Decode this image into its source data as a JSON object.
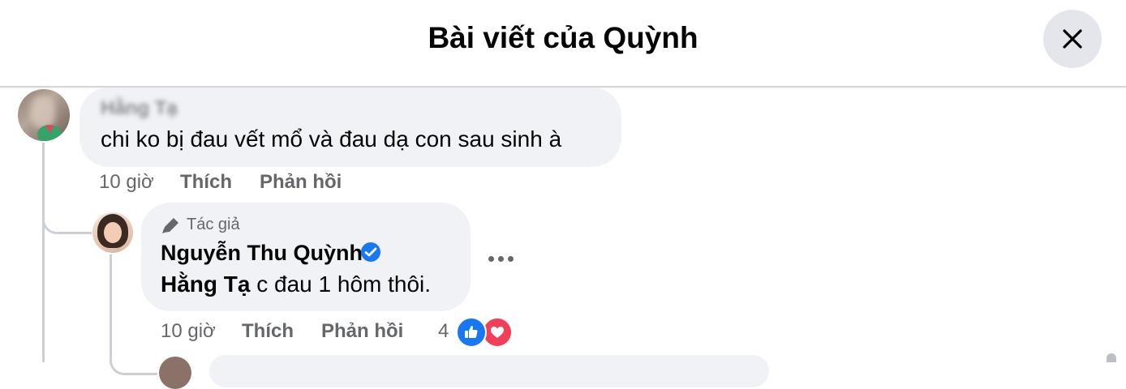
{
  "header": {
    "title": "Bài viết của Quỳnh",
    "close_icon": "close-icon"
  },
  "comments": [
    {
      "author": "Hằng Tạ",
      "text": "chi ko bị đau vết mổ và đau dạ con sau sinh à",
      "time": "10 giờ",
      "like_label": "Thích",
      "reply_label": "Phản hồi"
    }
  ],
  "reply": {
    "badge_label": "Tác giả",
    "badge_icon": "pen-icon",
    "author": "Nguyễn Thu Quỳnh",
    "verified_icon": "verified-badge-icon",
    "mention": "Hằng Tạ",
    "text": " c đau 1 hôm thôi.",
    "time": "10 giờ",
    "like_label": "Thích",
    "reply_label": "Phản hồi",
    "reaction_count": "4",
    "reaction_icons": [
      "like-icon",
      "love-icon"
    ]
  },
  "colors": {
    "bubble": "#f0f2f5",
    "secondary_text": "#65676b",
    "verified": "#1877f2",
    "like": "#1877f2",
    "love": "#f33e58"
  }
}
